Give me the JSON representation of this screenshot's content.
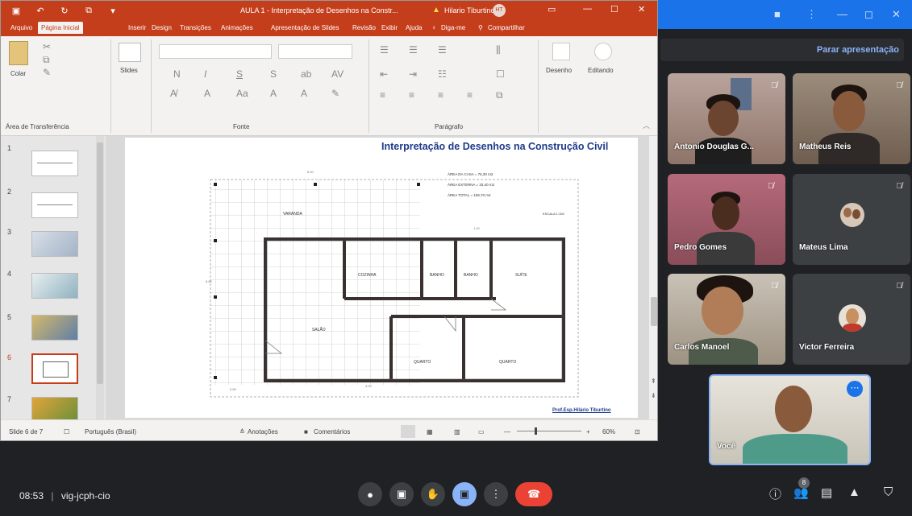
{
  "window": {
    "doc_title": "AULA 1 - Interpretação de Desenhos na Constr...",
    "user": "Hilario Tiburtino",
    "user_initials": "HT",
    "warning_icon": "warning-icon"
  },
  "ribbon_tabs": [
    "Arquivo",
    "Página Inicial",
    "Inserir",
    "Design",
    "Transições",
    "Animações",
    "Apresentação de Slides",
    "Revisão",
    "Exibir",
    "Ajuda",
    "Diga-me",
    "Compartilhar"
  ],
  "ribbon": {
    "paste_label": "Colar",
    "clipboard_group": "Área de Transferência",
    "slides_label": "Slides",
    "font_group": "Fonte",
    "paragraph_group": "Parágrafo",
    "drawing_label": "Desenho",
    "editing_label": "Editando"
  },
  "thumbnails": [
    "1",
    "2",
    "3",
    "4",
    "5",
    "6",
    "7"
  ],
  "slide": {
    "title": "Interpretação de Desenhos na Construção Civil",
    "areas": [
      "ÁREA DA CASA = 76,30 m2",
      "ÁREA EXTERNA = 33,40 m2",
      "ÁREA TOTAL = 109,70 m2"
    ],
    "scale": "ESCALA 1:100",
    "rooms": {
      "varanda": "VARANDA",
      "cozinha": "COZINHA",
      "banho1": "BANHO",
      "banho2": "BANHO",
      "suite": "SUÍTE",
      "salao": "SALÃO",
      "quarto1": "QUARTO",
      "quarto2": "QUARTO"
    },
    "author": "Prof.Esp.Hilário Tiburtino"
  },
  "status": {
    "slide_counter": "Slide 6 de 7",
    "language": "Português (Brasil)",
    "notes": "Anotações",
    "comments": "Comentários",
    "zoom": "60%"
  },
  "meet": {
    "stop_presenting": "Parar apresentação",
    "participants": [
      {
        "name": "Antonio Douglas G..."
      },
      {
        "name": "Matheus Reis"
      },
      {
        "name": "Pedro Gomes"
      },
      {
        "name": "Mateus Lima"
      },
      {
        "name": "Carlos Manoel"
      },
      {
        "name": "Victor Ferreira"
      }
    ],
    "self_label": "Você",
    "time": "08:53",
    "meeting_code": "vig-jcph-cio",
    "people_badge": "8"
  },
  "colors": {
    "ppt_red": "#c43e1c",
    "meet_bg": "#202124",
    "meet_blue": "#1a73e8",
    "hangup": "#ea4335"
  }
}
